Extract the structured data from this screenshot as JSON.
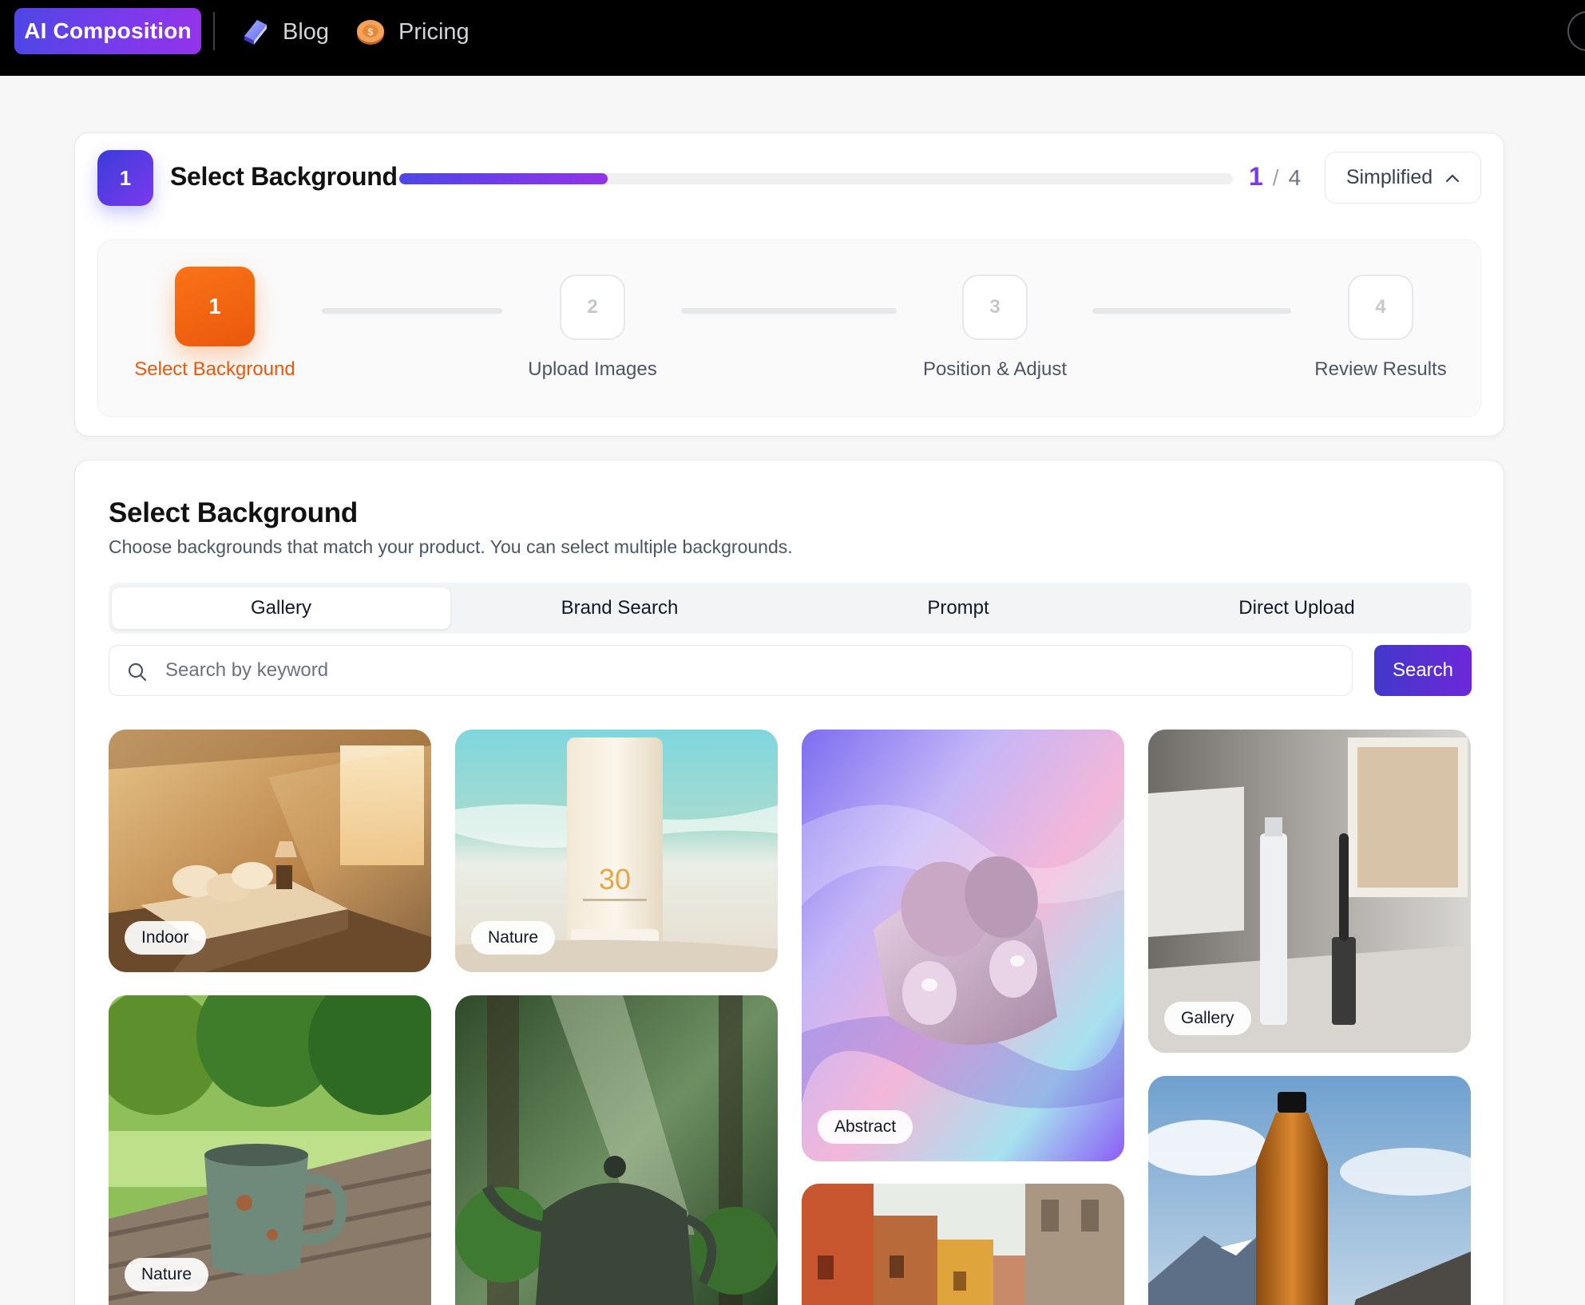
{
  "nav": {
    "brand": "AI Composition",
    "links": [
      {
        "label": "Blog",
        "icon": "book-icon"
      },
      {
        "label": "Pricing",
        "icon": "coin-icon"
      }
    ]
  },
  "progress": {
    "current_step": "1",
    "title": "Select Background",
    "current": "1",
    "separator": "/",
    "total": "4",
    "percent": 25,
    "mode_label": "Simplified"
  },
  "steps": [
    {
      "number": "1",
      "label": "Select Background",
      "state": "active"
    },
    {
      "number": "2",
      "label": "Upload Images",
      "state": "pending"
    },
    {
      "number": "3",
      "label": "Position & Adjust",
      "state": "pending"
    },
    {
      "number": "4",
      "label": "Review Results",
      "state": "pending"
    }
  ],
  "main": {
    "title": "Select Background",
    "subtitle": "Choose backgrounds that match your product. You can select multiple backgrounds.",
    "tabs": [
      "Gallery",
      "Brand Search",
      "Prompt",
      "Direct Upload"
    ],
    "active_tab": "Gallery",
    "search": {
      "placeholder": "Search by keyword",
      "value": "",
      "button": "Search"
    }
  },
  "gallery": [
    {
      "tag": "Indoor",
      "subject": "bedroom"
    },
    {
      "tag": "Nature",
      "subject": "sunscreen-beach"
    },
    {
      "tag": "Abstract",
      "subject": "earbuds-silk"
    },
    {
      "tag": "Gallery",
      "subject": "mascara-gallery"
    },
    {
      "tag": "Nature",
      "subject": "mug-park"
    },
    {
      "tag": "",
      "subject": "teapot-forest"
    },
    {
      "tag": "",
      "subject": "street-buildings"
    },
    {
      "tag": "",
      "subject": "bottle-mountain"
    }
  ],
  "colors": {
    "brand_gradient": [
      "#4f46e5",
      "#9333ea"
    ],
    "active_step": "#f97316",
    "accent": "#7c3aed"
  }
}
